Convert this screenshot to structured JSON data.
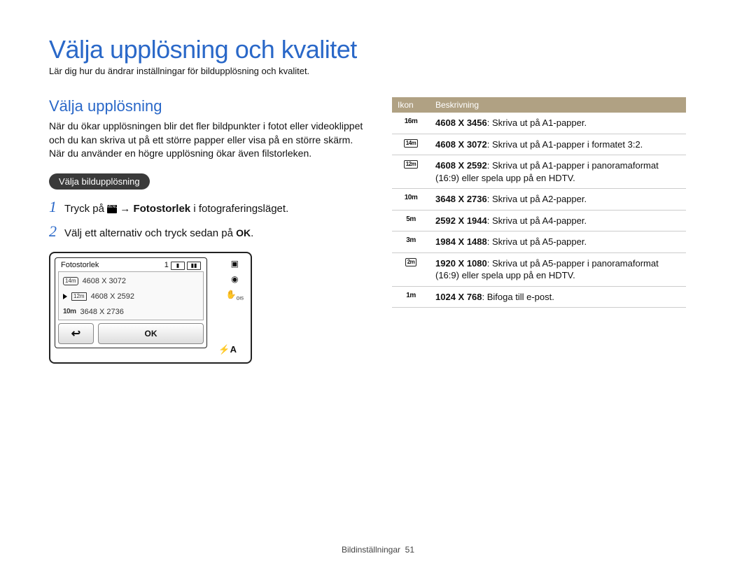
{
  "page": {
    "title": "Välja upplösning och kvalitet",
    "subtitle": "Lär dig hur du ändrar inställningar för bildupplösning och kvalitet.",
    "footer_label": "Bildinställningar",
    "footer_page": "51"
  },
  "left": {
    "heading": "Välja upplösning",
    "paragraph": "När du ökar upplösningen blir det fler bildpunkter i fotot eller videoklippet och du kan skriva ut på ett större papper eller visa på en större skärm. När du använder en högre upplösning ökar även filstorleken.",
    "pill": "Välja bildupplösning",
    "steps": [
      {
        "num": "1",
        "pre": "Tryck på ",
        "menu_icon_label": "MENU",
        "arrow": " → ",
        "bold": "Fotostorlek",
        "post": " i fotograferingsläget."
      },
      {
        "num": "2",
        "pre": "Välj ett alternativ och tryck sedan på ",
        "ok_label": "OK",
        "post": "."
      }
    ],
    "screenshot": {
      "title": "Fotostorlek",
      "count_label": "1",
      "items": [
        {
          "icon": "14m",
          "text": "4608 X 3072"
        },
        {
          "icon": "12m",
          "text": "4608 X 2592"
        },
        {
          "icon": "10m",
          "text": "3648 X 2736"
        }
      ],
      "back_arrow": "↩",
      "ok": "OK",
      "flash": "⚡A"
    }
  },
  "table": {
    "col_icon": "Ikon",
    "col_desc": "Beskrivning",
    "rows": [
      {
        "icon": "16m",
        "bold": "4608 X 3456",
        "text": ": Skriva ut på A1-papper."
      },
      {
        "icon": "14m",
        "boxed": true,
        "bold": "4608 X 3072",
        "text": ": Skriva ut på A1-papper i formatet 3:2."
      },
      {
        "icon": "12m",
        "boxed": true,
        "bold": "4608 X 2592",
        "text": ": Skriva ut på A1-papper i panoramaformat (16:9) eller spela upp på en HDTV."
      },
      {
        "icon": "10m",
        "bold": "3648 X 2736",
        "text": ": Skriva ut på A2-papper."
      },
      {
        "icon": "5m",
        "bold": "2592 X 1944",
        "text": ": Skriva ut på A4-papper."
      },
      {
        "icon": "3m",
        "bold": "1984 X 1488",
        "text": ": Skriva ut på A5-papper."
      },
      {
        "icon": "2m",
        "boxed": true,
        "bold": "1920 X 1080",
        "text": ": Skriva ut på A5-papper i panoramaformat (16:9) eller spela upp på en HDTV."
      },
      {
        "icon": "1m",
        "bold": "1024 X 768",
        "text": ": Bifoga till e-post."
      }
    ]
  }
}
